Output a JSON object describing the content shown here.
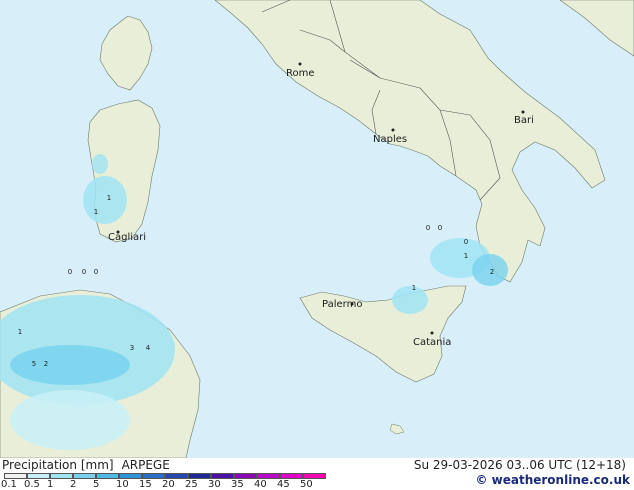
{
  "map": {
    "cities": [
      "Rome",
      "Naples",
      "Bari",
      "Cagliari",
      "Palermo",
      "Catania"
    ],
    "precip_values": [
      "0",
      "0",
      "0",
      "0",
      "0",
      "0",
      "1",
      "2",
      "1",
      "1",
      "1",
      "1",
      "3",
      "4",
      "5",
      "2"
    ]
  },
  "legend": {
    "title": "Precipitation [mm]",
    "model": "ARPEGE",
    "ticks": [
      "0.1",
      "0.5",
      "1",
      "2",
      "5",
      "10",
      "15",
      "20",
      "25",
      "30",
      "35",
      "40",
      "45",
      "50"
    ],
    "colors": [
      "#f2f2f2",
      "#c8f0f8",
      "#a0e4f4",
      "#78d2ee",
      "#50bae4",
      "#3294d8",
      "#2a6ec6",
      "#2448ae",
      "#1e2896",
      "#4a10a8",
      "#8a08b8",
      "#b808c8",
      "#dc08c8",
      "#f008b4"
    ]
  },
  "valid_time": "Su 29-03-2026 03..06 UTC (12+18)",
  "credit": "© weatheronline.co.uk"
}
